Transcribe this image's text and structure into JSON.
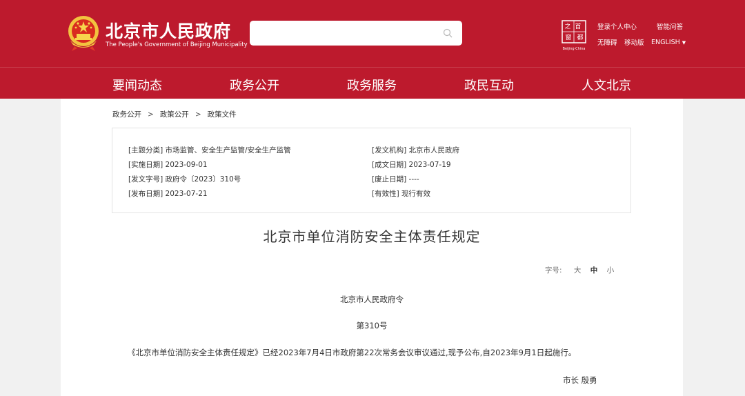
{
  "header": {
    "site_title": "北京市人民政府",
    "site_subtitle": "The People's Government of Beijing Municipality",
    "search_placeholder": "",
    "login_label": "登录个人中心",
    "qa_label": "智能问答",
    "accessibility_label": "无障碍",
    "mobile_label": "移动版",
    "language_label": "ENGLISH",
    "capital_logo_chars": [
      "首",
      "都",
      "之",
      "窗"
    ],
    "capital_logo_caption": "Beijing·China",
    "brand_color": "#bd1a2d"
  },
  "nav": {
    "items": [
      "要闻动态",
      "政务公开",
      "政务服务",
      "政民互动",
      "人文北京"
    ]
  },
  "breadcrumb": [
    "政务公开",
    "政策公开",
    "政策文件"
  ],
  "meta": {
    "topic": "[主题分类] 市场监管、安全生产监管/安全生产监管",
    "issuer": "[发文机构] 北京市人民政府",
    "effective_date": "[实施日期] 2023-09-01",
    "created_date": "[成文日期] 2023-07-19",
    "doc_number": "[发文字号] 政府令〔2023〕310号",
    "repeal_date": "[废止日期] ----",
    "publish_date": "[发布日期] 2023-07-21",
    "validity": "[有效性] 现行有效"
  },
  "document": {
    "title": "北京市单位消防安全主体责任规定",
    "fontsize_label": "字号:",
    "fontsize_options": [
      "大",
      "中",
      "小"
    ],
    "decree_heading": "北京市人民政府令",
    "decree_number": "第310号",
    "body": "《北京市单位消防安全主体责任规定》已经2023年7月4日市政府第22次常务会议审议通过,现予公布,自2023年9月1日起施行。",
    "signature": "市长 殷勇"
  }
}
